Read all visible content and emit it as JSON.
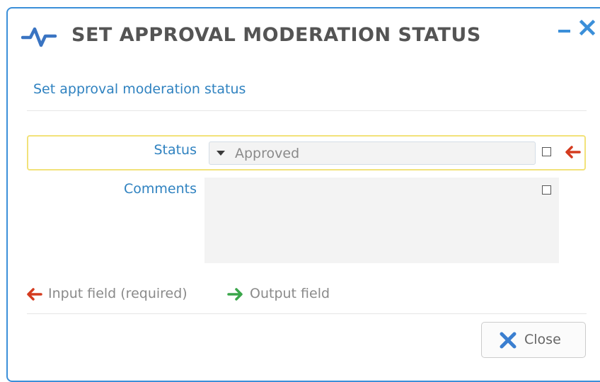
{
  "dialog": {
    "title": "SET APPROVAL MODERATION STATUS",
    "subtitle": "Set approval moderation status",
    "icon": "pulse-icon"
  },
  "window_controls": {
    "minimize_icon": "minimize-icon",
    "close_icon": "close-x-icon"
  },
  "form": {
    "status": {
      "label": "Status",
      "value": "Approved"
    },
    "comments": {
      "label": "Comments",
      "value": ""
    }
  },
  "legend": {
    "input_label": "Input field (required)",
    "output_label": "Output field"
  },
  "footer": {
    "close_label": "Close"
  },
  "colors": {
    "accent_blue": "#2f82c0",
    "border_blue": "#3b8fd9",
    "required_red": "#d43b1f",
    "output_green": "#3aa64a",
    "highlight_yellow": "#f2e27a"
  }
}
